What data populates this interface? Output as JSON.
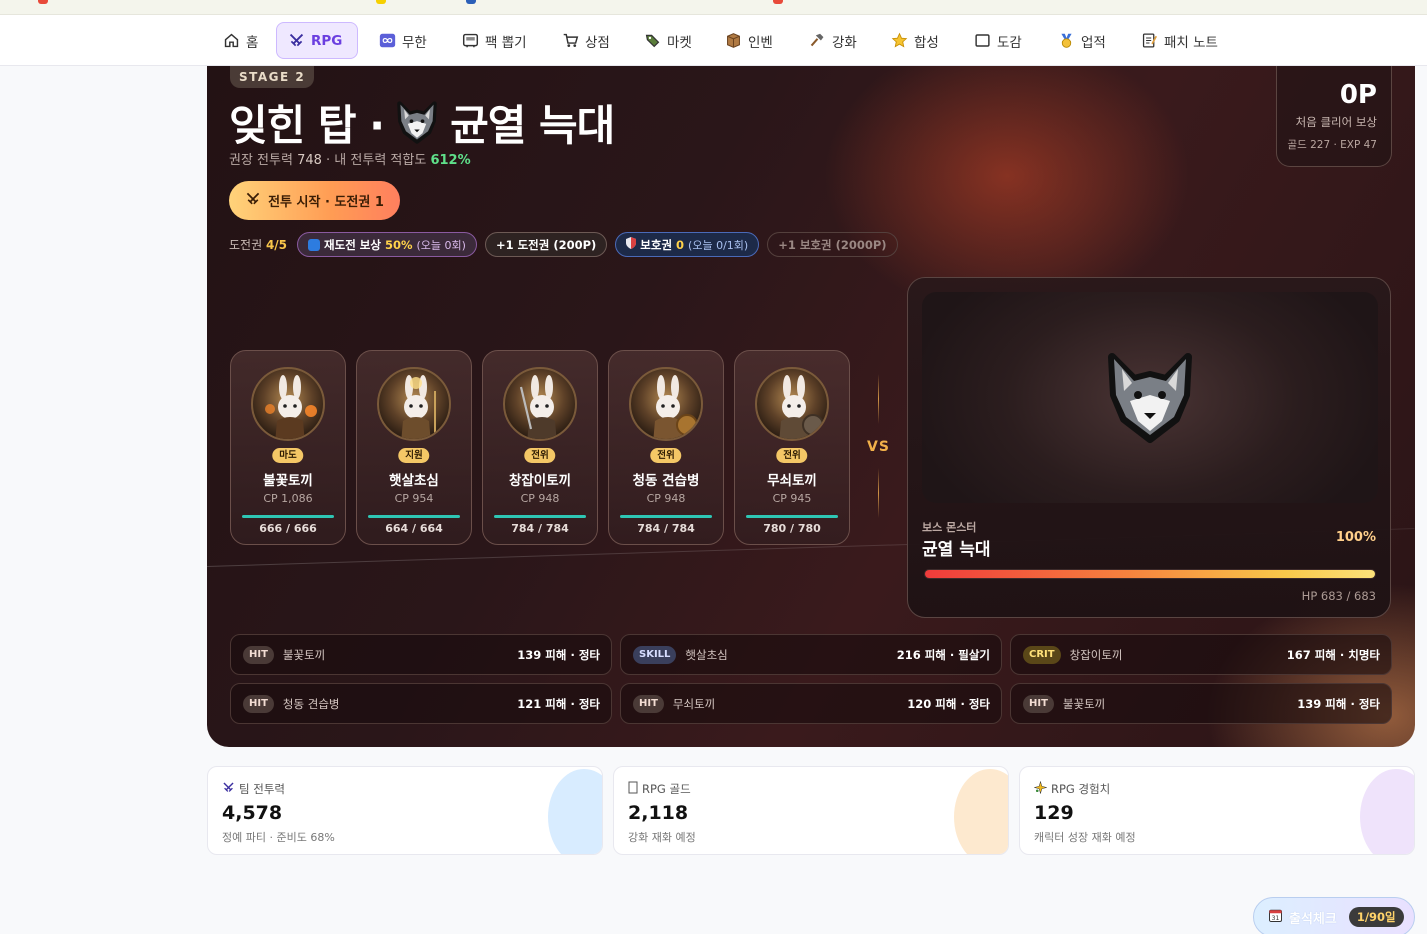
{
  "nav": {
    "items": [
      {
        "label": "홈",
        "icon": "home-icon"
      },
      {
        "label": "RPG",
        "icon": "crossed-swords-icon",
        "active": true
      },
      {
        "label": "무한",
        "icon": "infinity-icon"
      },
      {
        "label": "팩 뽑기",
        "icon": "pack-icon"
      },
      {
        "label": "상점",
        "icon": "cart-icon"
      },
      {
        "label": "마켓",
        "icon": "market-icon"
      },
      {
        "label": "인벤",
        "icon": "inventory-icon"
      },
      {
        "label": "강화",
        "icon": "hammer-icon"
      },
      {
        "label": "합성",
        "icon": "star-icon"
      },
      {
        "label": "도감",
        "icon": "book-icon"
      },
      {
        "label": "업적",
        "icon": "medal-icon"
      },
      {
        "label": "패치 노트",
        "icon": "memo-icon"
      }
    ]
  },
  "stage": {
    "badge": "STAGE 2",
    "title_prefix": "잊힌 탑 ·",
    "title_suffix": "균열 늑대",
    "subtitle_prefix": "권장 전투력",
    "recommended_cp": "748",
    "subtitle_mid": "· 내 전투력 적합도",
    "fitness": "612%",
    "start_button": "전투 시작 · 도전권 1",
    "tickets_label": "도전권",
    "tickets_value": "4/5",
    "retry_label": "재도전 보상",
    "retry_value": "50%",
    "retry_today": "(오늘 0회)",
    "buy_ticket": "+1 도전권 (200P)",
    "guard_label": "보호권",
    "guard_value": "0",
    "guard_today": "(오늘 0/1회)",
    "buy_guard": "+1 보호권 (2000P)"
  },
  "reward": {
    "points": "0P",
    "label": "처음 클리어 보상",
    "detail": "골드 227 · EXP 47"
  },
  "party": [
    {
      "role": "마도",
      "name": "불꽃토끼",
      "cp": "CP 1,086",
      "hp": "666 / 666"
    },
    {
      "role": "지원",
      "name": "햇살초심",
      "cp": "CP 954",
      "hp": "664 / 664"
    },
    {
      "role": "전위",
      "name": "창잡이토끼",
      "cp": "CP 948",
      "hp": "784 / 784"
    },
    {
      "role": "전위",
      "name": "청동 견습병",
      "cp": "CP 948",
      "hp": "784 / 784"
    },
    {
      "role": "전위",
      "name": "무쇠토끼",
      "cp": "CP 945",
      "hp": "780 / 780"
    }
  ],
  "vs": "VS",
  "boss": {
    "tag": "보스 몬스터",
    "name": "균열 늑대",
    "percent": "100%",
    "hp_fraction": 1.0,
    "hp": "HP 683 / 683"
  },
  "log": [
    {
      "kind": "HIT",
      "who": "불꽃토끼",
      "dmg": "139 피해 · 정타"
    },
    {
      "kind": "SKILL",
      "who": "햇살초심",
      "dmg": "216 피해 · 필살기"
    },
    {
      "kind": "CRIT",
      "who": "창잡이토끼",
      "dmg": "167 피해 · 치명타"
    },
    {
      "kind": "HIT",
      "who": "청동 견습병",
      "dmg": "121 피해 · 정타"
    },
    {
      "kind": "HIT",
      "who": "무쇠토끼",
      "dmg": "120 피해 · 정타"
    },
    {
      "kind": "HIT",
      "who": "불꽃토끼",
      "dmg": "139 피해 · 정타"
    }
  ],
  "stats": [
    {
      "label": "팀 전투력",
      "icon": "crossed-swords-icon",
      "value": "4,578",
      "sub": "정예 파티 · 준비도 68%",
      "accent": "#d8ecff"
    },
    {
      "label": "RPG 골드",
      "icon": "coin-icon",
      "value": "2,118",
      "sub": "강화 재화 예정",
      "accent": "#fde9cf"
    },
    {
      "label": "RPG 경험치",
      "icon": "sparkle-icon",
      "value": "129",
      "sub": "캐릭터 성장 재화 예정",
      "accent": "#efe3fb"
    }
  ],
  "attendance": {
    "label": "출석체크",
    "count": "1/90일"
  },
  "colors": {
    "accent": "#6b3fe0",
    "hp_bar": "#2ec6b4",
    "fitness": "#5fe08a",
    "role_badge": "#f4c766"
  }
}
